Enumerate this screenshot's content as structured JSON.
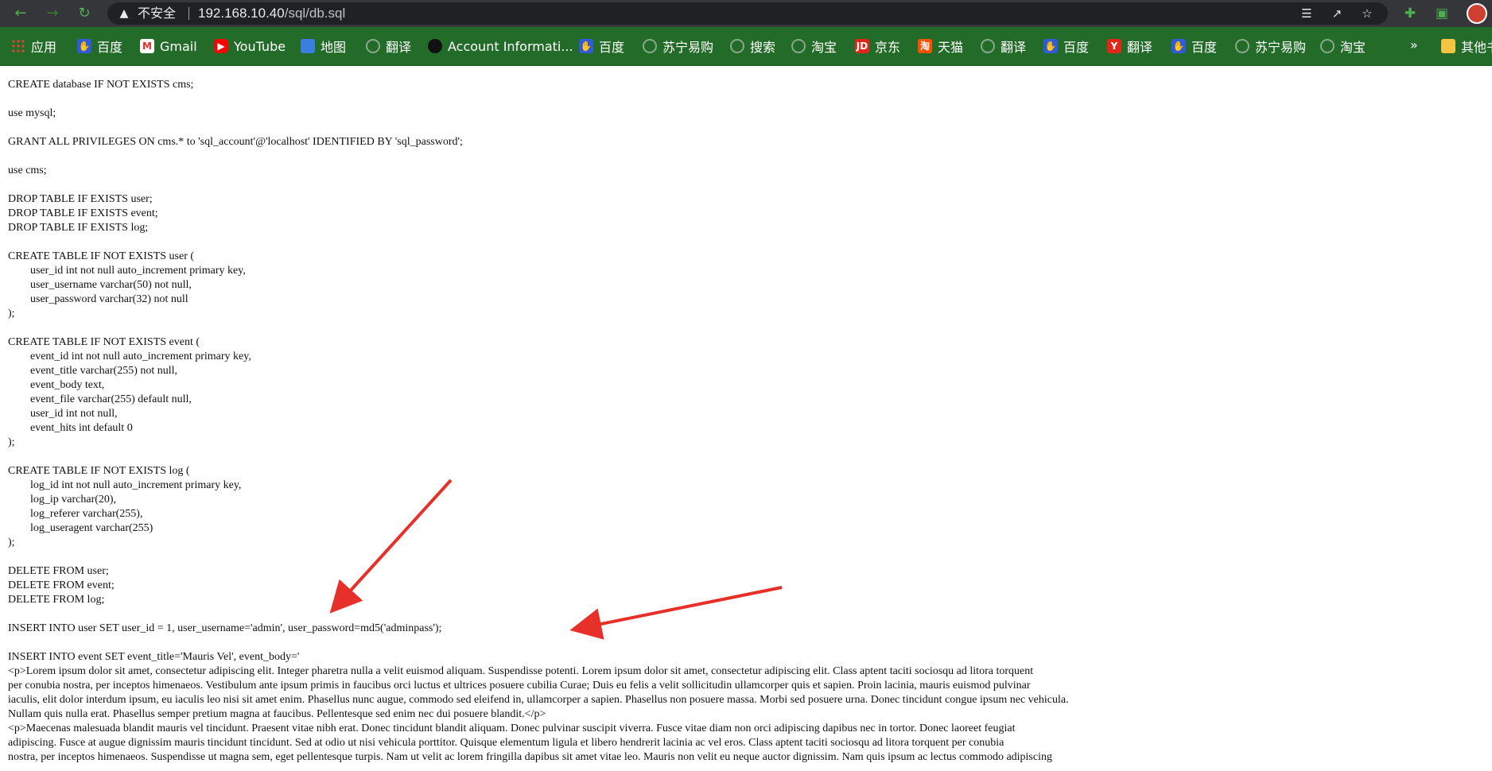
{
  "browser": {
    "insecure_label": "不安全",
    "url_host": "192.168.10.40",
    "url_path": "/sql/db.sql"
  },
  "bookmarks": [
    {
      "label": "应用",
      "icon": "apps-grid-icon"
    },
    {
      "label": "百度",
      "icon": "baidu-icon"
    },
    {
      "label": "Gmail",
      "icon": "gmail-icon"
    },
    {
      "label": "YouTube",
      "icon": "youtube-icon"
    },
    {
      "label": "地图",
      "icon": "maps-icon"
    },
    {
      "label": "翻译",
      "icon": "globe-icon"
    },
    {
      "label": "Account Informati...",
      "icon": "account-icon"
    },
    {
      "label": "百度",
      "icon": "baidu-icon"
    },
    {
      "label": "苏宁易购",
      "icon": "globe-icon"
    },
    {
      "label": "搜索",
      "icon": "globe-icon"
    },
    {
      "label": "淘宝",
      "icon": "globe-icon"
    },
    {
      "label": "京东",
      "icon": "jd-icon"
    },
    {
      "label": "天猫",
      "icon": "taobao-icon"
    },
    {
      "label": "翻译",
      "icon": "globe-icon"
    },
    {
      "label": "百度",
      "icon": "baidu-icon"
    },
    {
      "label": "翻译",
      "icon": "translate-icon"
    },
    {
      "label": "百度",
      "icon": "baidu-icon"
    },
    {
      "label": "苏宁易购",
      "icon": "globe-icon"
    },
    {
      "label": "淘宝",
      "icon": "globe-icon"
    }
  ],
  "bookmarks_more": "»",
  "other_bookmarks": "其他书签",
  "sql_lines": [
    "CREATE database IF NOT EXISTS cms;",
    "",
    "use mysql;",
    "",
    "GRANT ALL PRIVILEGES ON cms.* to 'sql_account'@'localhost' IDENTIFIED BY 'sql_password';",
    "",
    "use cms;",
    "",
    "DROP TABLE IF EXISTS user;",
    "DROP TABLE IF EXISTS event;",
    "DROP TABLE IF EXISTS log;",
    "",
    "CREATE TABLE IF NOT EXISTS user (",
    "        user_id int not null auto_increment primary key,",
    "        user_username varchar(50) not null,",
    "        user_password varchar(32) not null",
    ");",
    "",
    "CREATE TABLE IF NOT EXISTS event (",
    "        event_id int not null auto_increment primary key,",
    "        event_title varchar(255) not null,",
    "        event_body text,",
    "        event_file varchar(255) default null,",
    "        user_id int not null,",
    "        event_hits int default 0",
    ");",
    "",
    "CREATE TABLE IF NOT EXISTS log (",
    "        log_id int not null auto_increment primary key,",
    "        log_ip varchar(20),",
    "        log_referer varchar(255),",
    "        log_useragent varchar(255)",
    ");",
    "",
    "DELETE FROM user;",
    "DELETE FROM event;",
    "DELETE FROM log;",
    "",
    "INSERT INTO user SET user_id = 1, user_username='admin', user_password=md5('adminpass');",
    "",
    "INSERT INTO event SET event_title='Mauris Vel', event_body='"
  ],
  "paragraph_lines": [
    "<p>Lorem ipsum dolor sit amet, consectetur adipiscing elit. Integer pharetra nulla a velit euismod aliquam. Suspendisse potenti. Lorem ipsum dolor sit amet, consectetur adipiscing elit. Class aptent taciti sociosqu ad litora torquent",
    "per conubia nostra, per inceptos himenaeos. Vestibulum ante ipsum primis in faucibus orci luctus et ultrices posuere cubilia Curae; Duis eu felis a velit sollicitudin ullamcorper quis et sapien. Proin lacinia, mauris euismod pulvinar",
    "iaculis, elit dolor interdum ipsum, eu iaculis leo nisi sit amet enim. Phasellus nunc augue, commodo sed eleifend in, ullamcorper a sapien. Phasellus non posuere massa. Morbi sed posuere urna. Donec tincidunt congue ipsum nec vehicula.",
    "Nullam quis nulla erat. Phasellus semper pretium magna at faucibus. Pellentesque sed enim nec dui posuere blandit.</p>",
    "<p>Maecenas malesuada blandit mauris vel tincidunt. Praesent vitae nibh erat. Donec tincidunt blandit aliquam. Donec pulvinar suscipit viverra. Fusce vitae diam non orci adipiscing dapibus nec in tortor. Donec laoreet feugiat",
    "adipiscing. Fusce at augue dignissim mauris tincidunt tincidunt. Sed at odio ut nisi vehicula porttitor. Quisque elementum ligula et libero hendrerit lacinia ac vel eros. Class aptent taciti sociosqu ad litora torquent per conubia",
    "nostra, per inceptos himenaeos. Suspendisse ut magna sem, eget pellentesque turpis. Nam ut velit ac lorem fringilla dapibus sit amet vitae leo. Mauris non velit eu neque auctor dignissim. Nam quis ipsum ac lectus commodo adipiscing"
  ],
  "colors": {
    "annotation_arrow": "#e8302a",
    "bookmark_bar": "#236b28",
    "toolbar": "#35363a"
  }
}
